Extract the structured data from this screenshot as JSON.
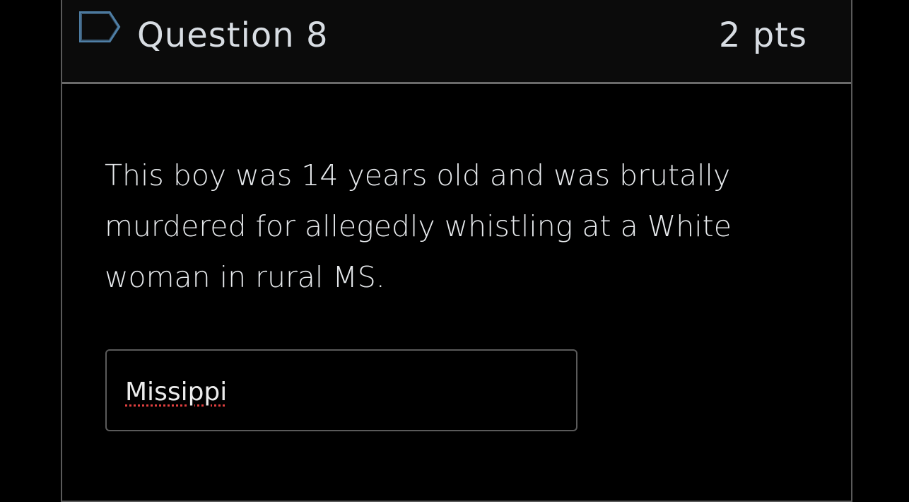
{
  "question": {
    "title": "Question 8",
    "points": "2 pts",
    "flag_icon": "flag-outline-icon",
    "text": "This boy was 14 years old and was brutally murdered for allegedly whistling at a White woman in rural MS.",
    "answer": {
      "value": "Missippi",
      "spellcheck_error": true
    }
  },
  "colors": {
    "background": "#000000",
    "header_background": "#0b0b0b",
    "border": "#5a5a5a",
    "text": "#e6e9ec",
    "flag_stroke": "#4f7fa6",
    "spellcheck_underline": "#e04040"
  }
}
